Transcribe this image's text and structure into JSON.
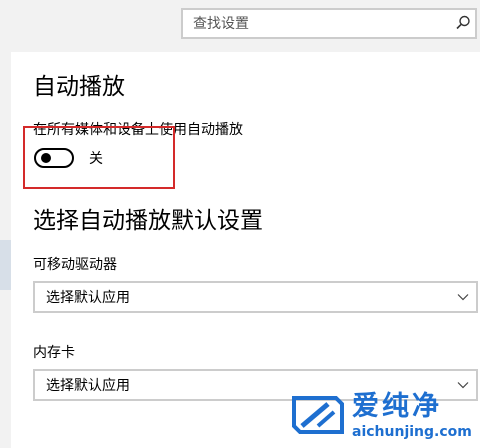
{
  "search": {
    "placeholder": "查找设置",
    "icon": "search-icon"
  },
  "autoplay": {
    "title": "自动播放",
    "toggle_label": "在所有媒体和设备上使用自动播放",
    "toggle_state_text": "关",
    "toggle_on": false
  },
  "defaults": {
    "title": "选择自动播放默认设置",
    "removable_drive": {
      "label": "可移动驱动器",
      "value": "选择默认应用"
    },
    "memory_card": {
      "label": "内存卡",
      "value": "选择默认应用"
    }
  },
  "watermark": {
    "name": "爱纯净",
    "url": "aichunjing.com"
  },
  "colors": {
    "highlight": "#d42a2a",
    "watermark": "#1e6fd0",
    "header_band": "#f2f2f2",
    "border": "#cccccc"
  }
}
